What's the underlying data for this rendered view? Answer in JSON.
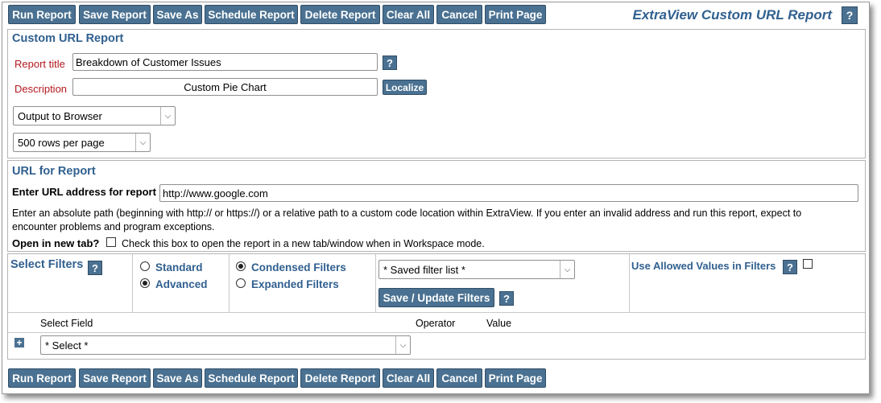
{
  "toolbar": {
    "buttons": [
      "Run Report",
      "Save Report",
      "Save As",
      "Schedule Report",
      "Delete Report",
      "Clear All",
      "Cancel",
      "Print Page"
    ],
    "title": "ExtraView Custom URL Report",
    "help": "?"
  },
  "custom_url_section": {
    "title": "Custom URL Report",
    "report_title_label": "Report title",
    "report_title_value": "Breakdown of Customer Issues",
    "description_label": "Description",
    "description_value": "Custom Pie Chart",
    "localize_label": "Localize",
    "output_select": "Output to Browser",
    "rows_select": "500 rows per page"
  },
  "url_section": {
    "title": "URL for Report",
    "url_label": "Enter URL address for report",
    "url_value": "http://www.google.com",
    "info_line1": "Enter an absolute path (beginning with http:// or https://) or a relative path to a custom code location within ExtraView. If you enter an invalid address and run this report, expect to",
    "info_line2": "encounter problems and program exceptions.",
    "new_tab_label": "Open in new tab?",
    "new_tab_desc": "Check this box to open the report in a new tab/window when in Workspace mode."
  },
  "filters": {
    "title": "Select Filters",
    "mode_standard": "Standard",
    "mode_advanced": "Advanced",
    "condensed": "Condensed Filters",
    "expanded": "Expanded Filters",
    "saved_filter_list": "* Saved filter list *",
    "save_update_label": "Save / Update Filters",
    "allowed_values_label": "Use Allowed Values in Filters",
    "col_select_field": "Select Field",
    "col_operator": "Operator",
    "col_value": "Value",
    "field_select": "* Select *"
  }
}
